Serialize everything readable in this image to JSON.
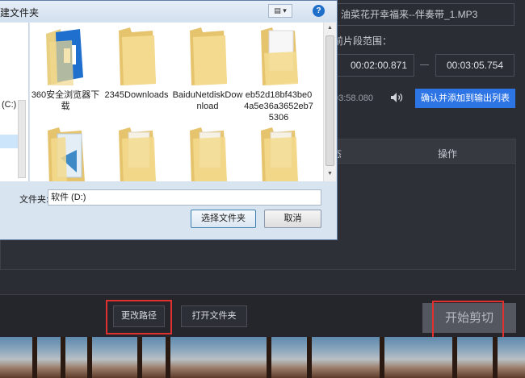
{
  "app": {
    "file_name": "油菜花开幸福来--伴奏带_1.MP3",
    "range_label": "前片段范围：",
    "start_time": "00:02:00.871",
    "end_time": "00:03:05.754",
    "current_time": "03:58.080",
    "confirm_button": "确认并添加到输出列表",
    "list_columns": {
      "status": "态",
      "action": "操作"
    },
    "change_path_button": "更改路径",
    "open_folder_button": "打开文件夹",
    "start_button": "开始剪切",
    "accent_color": "#2d74e4",
    "highlight_color": "#e0312f"
  },
  "dialog": {
    "title": "建文件夹",
    "view_icon": "view-menu-icon",
    "help_icon": "help-icon",
    "drive_label": "(C:)",
    "items": [
      {
        "label": "360安全浏览器下载",
        "icon": "folder-360-icon"
      },
      {
        "label": "2345Downloads",
        "icon": "folder-icon"
      },
      {
        "label": "BaiduNetdiskDownload",
        "icon": "folder-icon"
      },
      {
        "label": "eb52d18bf43be04a5e36a3652eb75306",
        "icon": "folder-document-icon"
      },
      {
        "label": "",
        "icon": "folder-video-icon"
      },
      {
        "label": "",
        "icon": "folder-icon"
      },
      {
        "label": "",
        "icon": "folder-icon"
      },
      {
        "label": "",
        "icon": "folder-icon"
      }
    ],
    "folder_label": "文件夹:",
    "folder_value": "软件 (D:)",
    "select_button": "选择文件夹",
    "cancel_button": "取消"
  }
}
